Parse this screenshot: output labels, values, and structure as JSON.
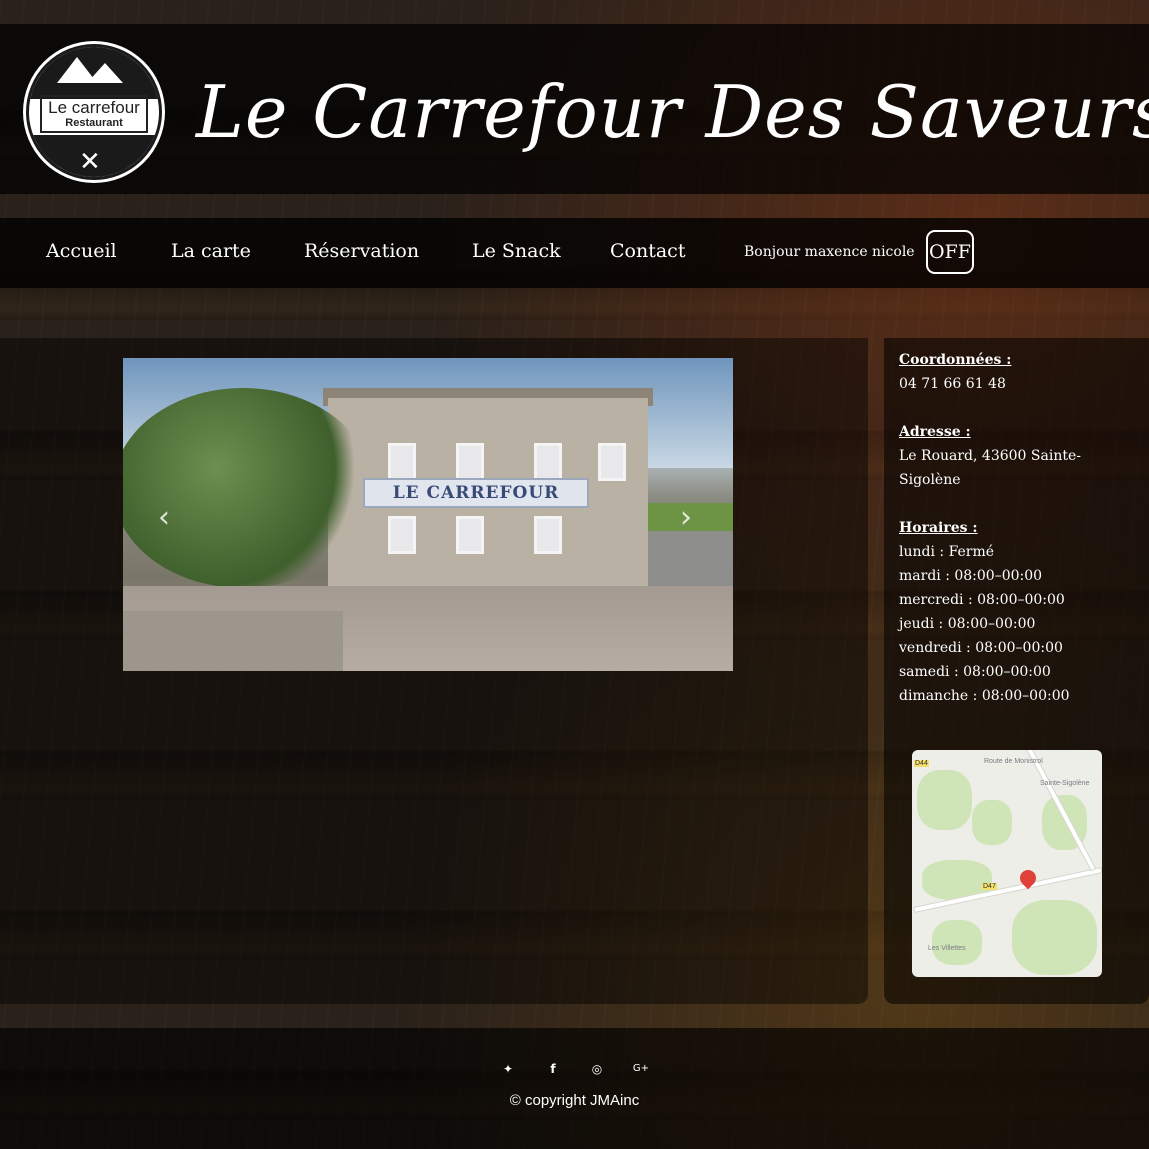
{
  "brand": {
    "logo_name": "Le carrefour",
    "logo_sub": "Restaurant",
    "title": "Le Carrefour Des Saveurs"
  },
  "nav": {
    "items": [
      {
        "label": "Accueil"
      },
      {
        "label": "La carte"
      },
      {
        "label": "Réservation"
      },
      {
        "label": "Le Snack"
      },
      {
        "label": "Contact"
      }
    ],
    "greeting": "Bonjour maxence nicole",
    "off_label": "OFF"
  },
  "carousel": {
    "sign_text": "LE CARREFOUR",
    "prev_icon": "chevron-left-icon",
    "next_icon": "chevron-right-icon"
  },
  "sidebar": {
    "contact_heading": "Coordonnées :",
    "phone": "04 71 66 61 48",
    "address_heading": "Adresse :",
    "address_line1": "Le Rouard, 43600 Sainte-",
    "address_line2": "Sigolène",
    "hours_heading": "Horaires :",
    "hours": [
      "lundi : Fermé",
      "mardi : 08:00–00:00",
      "mercredi : 08:00–00:00",
      "jeudi : 08:00–00:00",
      "vendredi : 08:00–00:00",
      "samedi : 08:00–00:00",
      "dimanche : 08:00–00:00"
    ]
  },
  "map": {
    "label_town": "Sainte-Sigolène",
    "label_road": "Route de Monistrol",
    "label_village": "Les Villettes",
    "badge_a": "D44",
    "badge_b": "D47"
  },
  "footer": {
    "social_icons": [
      "twitter-icon",
      "facebook-icon",
      "instagram-icon",
      "google-plus-icon"
    ],
    "copyright": "© copyright JMAinc"
  }
}
